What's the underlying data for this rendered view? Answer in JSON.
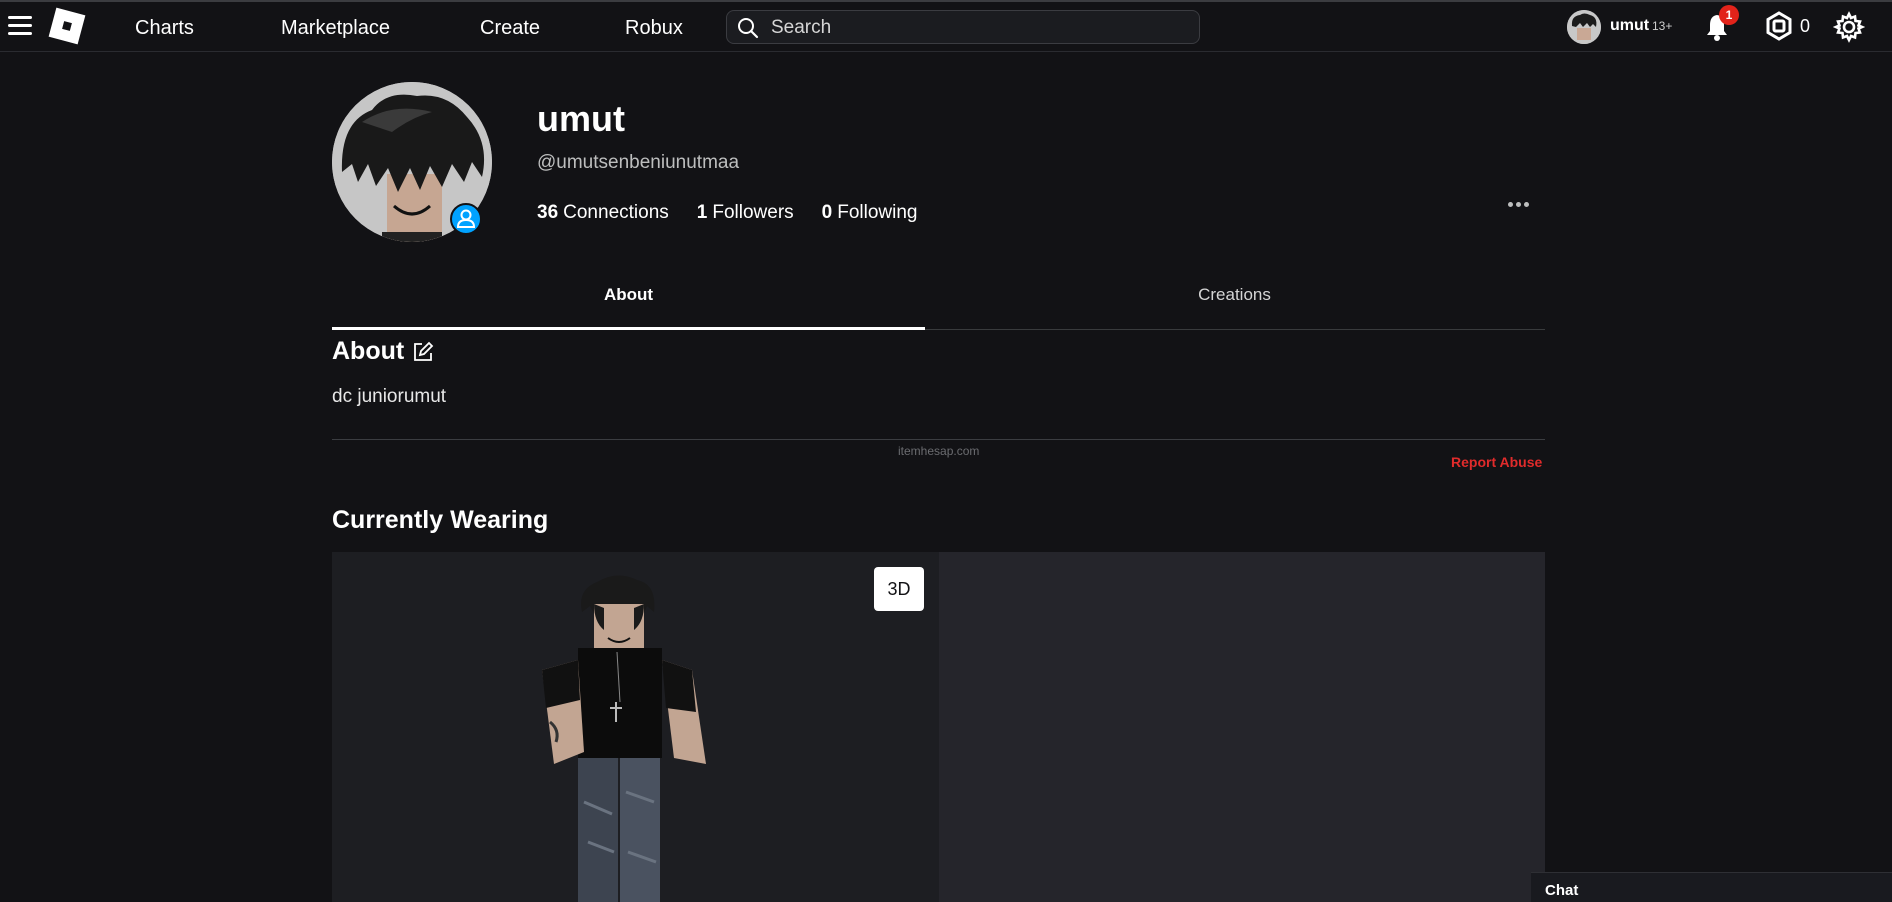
{
  "nav": {
    "links": [
      "Charts",
      "Marketplace",
      "Create",
      "Robux"
    ],
    "search_placeholder": "Search",
    "username": "umut",
    "age_badge": "13+",
    "notification_count": "1",
    "robux_balance": "0"
  },
  "profile": {
    "display_name": "umut",
    "username": "@umutsenbeniunutmaa",
    "stats": {
      "connections": {
        "count": "36",
        "label": "Connections"
      },
      "followers": {
        "count": "1",
        "label": "Followers"
      },
      "following": {
        "count": "0",
        "label": "Following"
      }
    }
  },
  "tabs": [
    {
      "label": "About",
      "active": true
    },
    {
      "label": "Creations",
      "active": false
    }
  ],
  "about": {
    "title": "About",
    "text": "dc juniorumut",
    "watermark": "itemhesap.com",
    "report_label": "Report Abuse"
  },
  "wearing": {
    "title": "Currently Wearing",
    "view_toggle": "3D"
  },
  "chat": {
    "label": "Chat"
  },
  "colors": {
    "accent_blue": "#00a2ff",
    "report_red": "#e02b2b",
    "background": "#121215"
  }
}
